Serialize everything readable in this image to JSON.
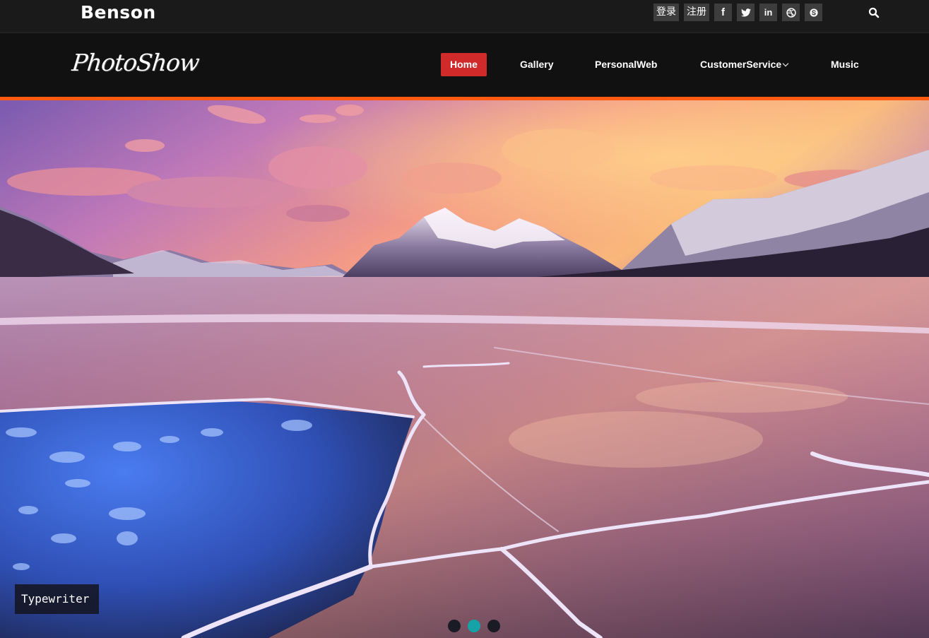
{
  "topbar": {
    "brand": "Benson",
    "login_label": "登录",
    "register_label": "注册",
    "social": [
      {
        "name": "facebook",
        "glyph": "f"
      },
      {
        "name": "twitter",
        "glyph": ""
      },
      {
        "name": "linkedin",
        "glyph": "in"
      },
      {
        "name": "dribbble",
        "glyph": ""
      },
      {
        "name": "skype",
        "glyph": ""
      }
    ]
  },
  "navbar": {
    "logo": "PhotoShow",
    "items": [
      {
        "label": "Home",
        "active": true
      },
      {
        "label": "Gallery"
      },
      {
        "label": "PersonalWeb"
      },
      {
        "label": "CustomerService"
      },
      {
        "label": "Music"
      }
    ]
  },
  "hero": {
    "caption": "Typewriter",
    "slides_total": 3,
    "active_slide": 2
  },
  "colors": {
    "accent_active": "#d12a2a",
    "rule": "#ff5a12",
    "dot_active": "#17a2a8"
  }
}
